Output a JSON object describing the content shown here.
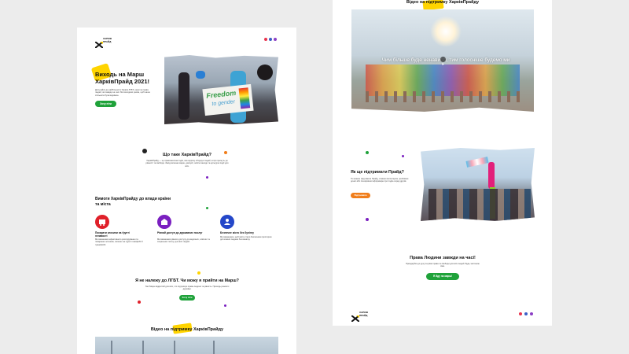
{
  "brand": {
    "logo_text": "ХАРКІВ ПРАЙД"
  },
  "colors": {
    "yellow": "#ffd400",
    "green": "#1fa23a",
    "red": "#e0202a",
    "purple": "#7a1fc0",
    "blue": "#2447c9",
    "orange": "#f07d1a",
    "social_red": "#e8344e",
    "social_blue": "#3b5ec6",
    "social_purple": "#8c3fc5"
  },
  "hero": {
    "title": "Виходь на Марш ХарківПрайд 2021!",
    "text": "Долучайся до найбільшої в Україні ЛГБТ+ акції за права людей, які завжди на часі. Ми виходимо разом, щоб наша спільнота була видимою.",
    "cta": "Хочу піти",
    "banner_text_1": "Freedom",
    "banner_text_2": "to gender"
  },
  "about": {
    "title": "Що таке ХарківПрайд?",
    "text": "ХарківПрайд — це правозахисна подія, яка щороку об'єднує людей, котрі прагнуть до рівності та свободи. Захід включає марш, дискусії, освітні заходи та культурні події для всіх."
  },
  "demands": {
    "title": "Вимоги ХарківПрайду до влади країни та міста",
    "items": [
      {
        "title": "Покарати злочини на ґрунті ненависті",
        "text": "Ми вимагаємо ефективного розслідування та покарання злочинів, скоєних на ґрунті гомофобії й трансфобії.",
        "icon": "bus-icon"
      },
      {
        "title": "Рівний доступ до державних послуг",
        "text": "Ми вимагаємо рівного доступу до медичних, освітніх та соціальних послуг для всіх людей.",
        "icon": "school-icon"
      },
      {
        "title": "Безпечне місто без булінгу",
        "text": "Ми вимагаємо, щоб місто стало безпечним простором для кожної людини без винятку.",
        "icon": "person-icon"
      }
    ]
  },
  "faq": {
    "title": "Я не належу до ЛГБТ. Чи можу я прийти на Марш?",
    "text": "Так! Марш відкритий для всіх, хто підтримує права людини та рівність. Приходь разом із друзями.",
    "cta": "Хочу піти"
  },
  "video": {
    "title": "Відео на підтримку ХарківПрайду",
    "caption": "Чим більше буде ненависті, тим голосніше будемо ми"
  },
  "support": {
    "title": "Як ще підтримати Прайд?",
    "text": "Ти можеш підтримати Прайд, ставши волонтером, зробивши донат або поширивши інформацію про подію серед друзів.",
    "cta": "Підтримати"
  },
  "rights": {
    "title": "Права Людини завжди на часі!",
    "text": "Приєднуйся до руху за рівні права та свободи для всіх людей. Будь частиною змін.",
    "cta": "Я йду на марш!"
  }
}
